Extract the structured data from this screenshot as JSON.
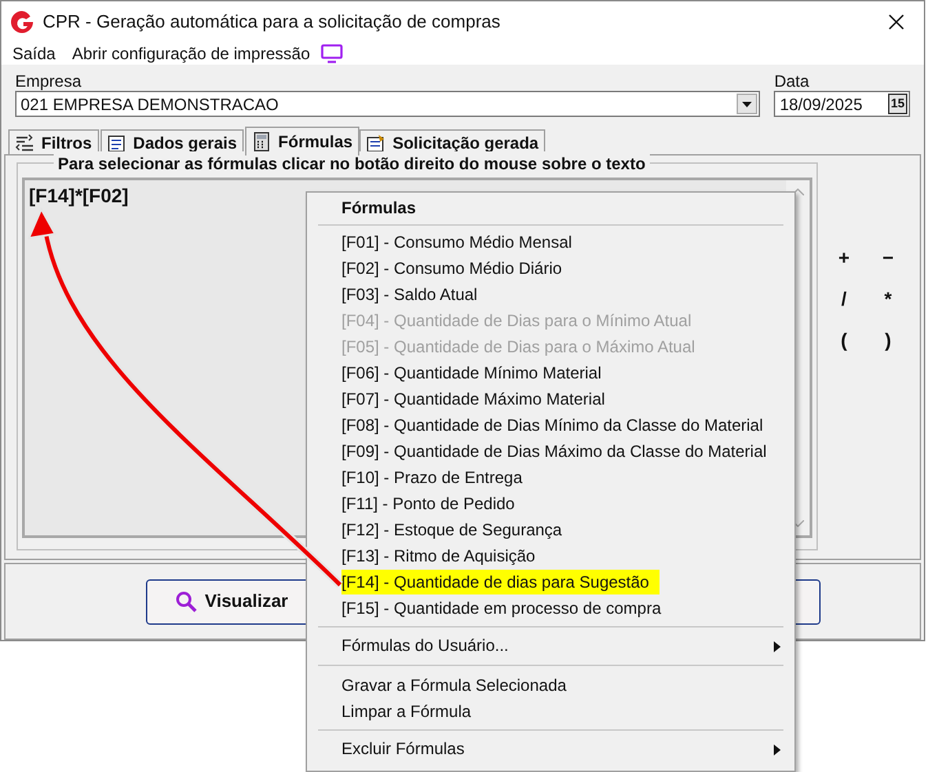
{
  "window": {
    "title": "CPR - Geração automática para a solicitação de compras"
  },
  "menu_bar": [
    "Saída",
    "Abrir configuração de impressão"
  ],
  "empresa": {
    "label": "Empresa",
    "value": "021 EMPRESA DEMONSTRACAO"
  },
  "data": {
    "label": "Data",
    "value": "18/09/2025",
    "button": "15"
  },
  "tabs": [
    {
      "label": "Filtros",
      "selected": false
    },
    {
      "label": "Dados gerais",
      "selected": false
    },
    {
      "label": "Fórmulas",
      "selected": true
    },
    {
      "label": "Solicitação gerada",
      "selected": false
    }
  ],
  "group_title": "Para selecionar as fórmulas clicar no botão direito do mouse sobre o texto",
  "formula": "[F14]*[F02]",
  "operators": [
    "+",
    "−",
    "/",
    "*",
    "(",
    ")"
  ],
  "buttons": [
    "Visualizar"
  ],
  "context_menu": {
    "title": "Fórmulas",
    "items": [
      {
        "kind": "item",
        "label": "[F01] - Consumo Médio Mensal",
        "disabled": false,
        "highlighted": false
      },
      {
        "kind": "item",
        "label": "[F02] - Consumo Médio Diário",
        "disabled": false,
        "highlighted": false
      },
      {
        "kind": "item",
        "label": "[F03] - Saldo Atual",
        "disabled": false,
        "highlighted": false
      },
      {
        "kind": "item",
        "label": "[F04] - Quantidade de Dias para o Mínimo Atual",
        "disabled": true,
        "highlighted": false
      },
      {
        "kind": "item",
        "label": "[F05] - Quantidade de Dias para o Máximo Atual",
        "disabled": true,
        "highlighted": false
      },
      {
        "kind": "item",
        "label": "[F06] - Quantidade Mínimo Material",
        "disabled": false,
        "highlighted": false
      },
      {
        "kind": "item",
        "label": "[F07] - Quantidade Máximo Material",
        "disabled": false,
        "highlighted": false
      },
      {
        "kind": "item",
        "label": "[F08] - Quantidade de Dias Mínimo da Classe do Material",
        "disabled": false,
        "highlighted": false
      },
      {
        "kind": "item",
        "label": "[F09] - Quantidade de Dias Máximo da Classe do Material",
        "disabled": false,
        "highlighted": false
      },
      {
        "kind": "item",
        "label": "[F10] - Prazo de Entrega",
        "disabled": false,
        "highlighted": false
      },
      {
        "kind": "item",
        "label": "[F11] - Ponto de Pedido",
        "disabled": false,
        "highlighted": false
      },
      {
        "kind": "item",
        "label": "[F12] - Estoque de Segurança",
        "disabled": false,
        "highlighted": false
      },
      {
        "kind": "item",
        "label": "[F13] - Ritmo de Aquisição",
        "disabled": false,
        "highlighted": false
      },
      {
        "kind": "item",
        "label": "[F14] - Quantidade de dias para Sugestão",
        "disabled": false,
        "highlighted": true
      },
      {
        "kind": "item",
        "label": "[F15] - Quantidade em processo de compra",
        "disabled": false,
        "highlighted": false
      },
      {
        "kind": "separator"
      },
      {
        "kind": "submenu",
        "label": "Fórmulas do Usuário..."
      },
      {
        "kind": "separator"
      },
      {
        "kind": "item",
        "label": "Gravar a Fórmula Selecionada",
        "disabled": false,
        "highlighted": false
      },
      {
        "kind": "item",
        "label": "Limpar a Fórmula",
        "disabled": false,
        "highlighted": false
      },
      {
        "kind": "separator"
      },
      {
        "kind": "submenu",
        "label": "Excluir Fórmulas"
      }
    ]
  }
}
